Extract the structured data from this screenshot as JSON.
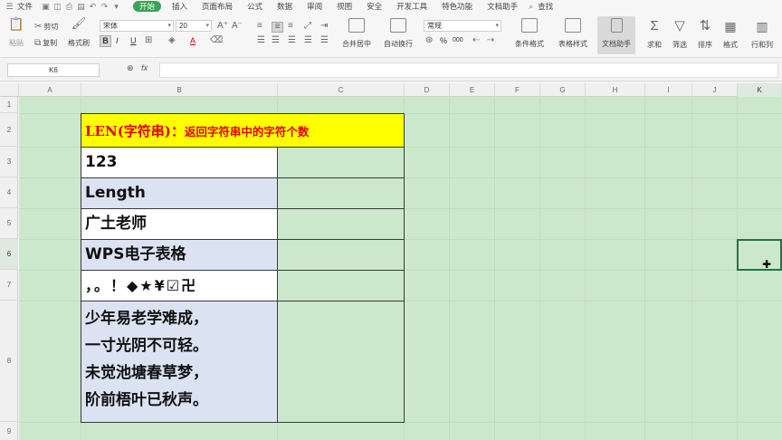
{
  "menubar": {
    "file": "文件",
    "tabs": [
      "开始",
      "插入",
      "页面布局",
      "公式",
      "数据",
      "审阅",
      "视图",
      "安全",
      "开发工具",
      "特色功能",
      "文档助手"
    ],
    "search": "查找"
  },
  "ribbon": {
    "cut": "剪切",
    "copy": "复制",
    "format_painter": "格式刷",
    "paste": "粘贴",
    "font_name": "宋体",
    "font_size": "20",
    "merge_center": "合并居中",
    "wrap": "自动换行",
    "number_format": "常规",
    "cond_format": "条件格式",
    "table_style": "表格样式",
    "doc_helper": "文档助手",
    "sum": "求和",
    "filter": "筛选",
    "sort": "排序",
    "format": "格式",
    "rows_cols": "行和列",
    "bold": "B",
    "italic": "I",
    "underline": "U",
    "font_color": "A",
    "percent": "%",
    "comma": "000"
  },
  "formula_bar": {
    "cell_ref": "K6",
    "fx": "fx",
    "content": ""
  },
  "columns": [
    "A",
    "B",
    "C",
    "D",
    "E",
    "F",
    "G",
    "H",
    "I",
    "J",
    "K"
  ],
  "rows": [
    "1",
    "2",
    "3",
    "4",
    "5",
    "6",
    "7",
    "8",
    "9"
  ],
  "table": {
    "title_main": "LEN(字符串)：",
    "title_desc": "返回字符串中的字符个数",
    "cells": [
      "123",
      "Length",
      "广土老师",
      "WPS电子表格",
      "，。！◆★¥☑卍"
    ],
    "poem": [
      "少年易老学难成，",
      "一寸光阴不可轻。",
      "未觉池塘春草梦，",
      "阶前梧叶已秋声。"
    ]
  },
  "selection": {
    "cell": "K6"
  },
  "colors": {
    "grid_bg": "#cce8cc",
    "title_bg": "#ffff00",
    "title_text": "#e00000",
    "alt_row": "#dbe3f3",
    "selection": "#217346",
    "active_tab": "#3aa355"
  }
}
